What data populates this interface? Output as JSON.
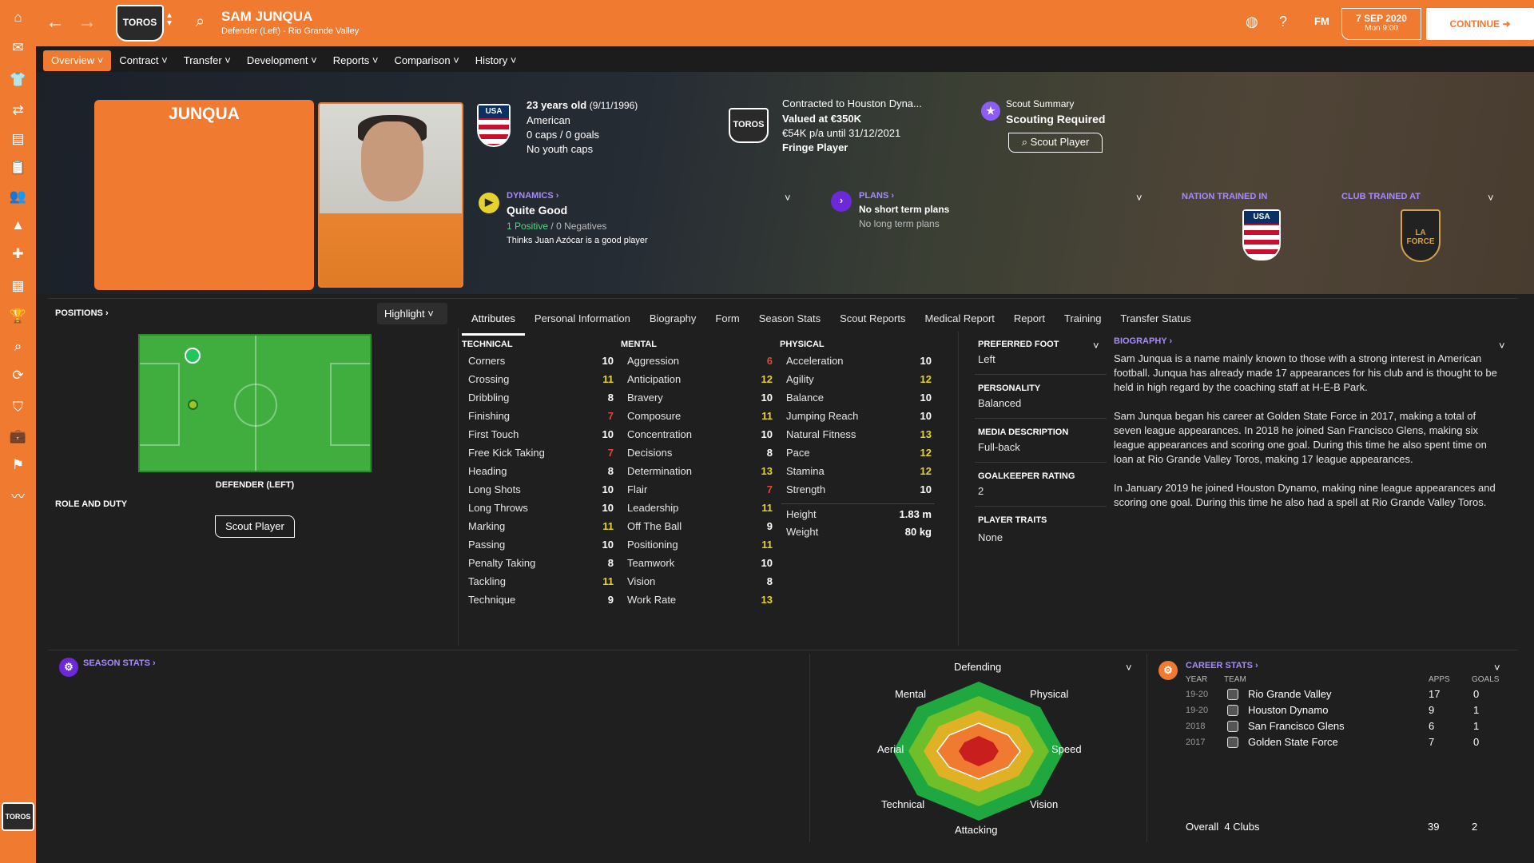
{
  "colors": {
    "accent": "#f07a2f",
    "purple": "#a78bfa",
    "green": "#3fae3f",
    "value_red": "#e0483a",
    "value_yellow": "#e6d22d",
    "value_white": "#ffffff"
  },
  "sidebar": {
    "icons": [
      "home-icon",
      "inbox-icon",
      "squad-icon",
      "tactics-icon",
      "data-hub-icon",
      "clipboard-icon",
      "staff-icon",
      "training-icon",
      "medical-icon",
      "schedule-icon",
      "competitions-icon",
      "scouting-icon",
      "transfers-icon",
      "club-info-icon",
      "finances-icon",
      "dev-centre-icon",
      "analytics-icon"
    ],
    "club_logo": "TOROS"
  },
  "header": {
    "club_badge": "TOROS",
    "player_name": "SAM JUNQUA",
    "player_subtitle": "Defender (Left) - Rio Grande Valley",
    "fm_label": "FM",
    "date": "7 SEP 2020",
    "time": "Mon 9:00",
    "continue_label": "CONTINUE"
  },
  "tabs": [
    {
      "label": "Overview"
    },
    {
      "label": "Contract"
    },
    {
      "label": "Transfer"
    },
    {
      "label": "Development"
    },
    {
      "label": "Reports"
    },
    {
      "label": "Comparison"
    },
    {
      "label": "History"
    }
  ],
  "hero": {
    "shirt_name": "JUNQUA",
    "nation_badge": "USA",
    "age_line": "23 years old",
    "dob": "(9/11/1996)",
    "nationality": "American",
    "caps": "0 caps / 0 goals",
    "youth_caps": "No youth caps",
    "contract_badge": "TOROS",
    "contracted_to": "Contracted to Houston Dyna...",
    "valued_at": "Valued at €350K",
    "wage": "€54K p/a until 31/12/2021",
    "squad_status": "Fringe Player",
    "scout_summary_label": "Scout Summary",
    "scout_summary_value": "Scouting Required",
    "scout_player_btn": "Scout Player",
    "dynamics_label": "DYNAMICS",
    "dynamics_value": "Quite Good",
    "positives": "1 Positive",
    "negatives": "0 Negatives",
    "dynamics_note": "Thinks Juan Azócar is a good player",
    "plans_label": "PLANS",
    "plans_short": "No short term plans",
    "plans_long": "No long term plans",
    "nation_trained_label": "NATION TRAINED IN",
    "nation_trained_badge": "USA",
    "club_trained_label": "CLUB TRAINED AT",
    "club_trained_badge": "LA FORCE"
  },
  "positions": {
    "label": "POSITIONS",
    "highlight_label": "Highlight",
    "position_name": "DEFENDER (LEFT)",
    "role_duty_label": "ROLE AND DUTY",
    "scout_btn": "Scout Player"
  },
  "sub_tabs": [
    "Attributes",
    "Personal Information",
    "Biography",
    "Form",
    "Season Stats",
    "Scout Reports",
    "Medical Report",
    "Report",
    "Training",
    "Transfer Status"
  ],
  "attributes": {
    "technical_label": "TECHNICAL",
    "mental_label": "MENTAL",
    "physical_label": "PHYSICAL",
    "technical": [
      [
        "Corners",
        "10",
        "w"
      ],
      [
        "Crossing",
        "11",
        "y"
      ],
      [
        "Dribbling",
        "8",
        "w"
      ],
      [
        "Finishing",
        "7",
        "r"
      ],
      [
        "First Touch",
        "10",
        "w"
      ],
      [
        "Free Kick Taking",
        "7",
        "r"
      ],
      [
        "Heading",
        "8",
        "w"
      ],
      [
        "Long Shots",
        "10",
        "w"
      ],
      [
        "Long Throws",
        "10",
        "w"
      ],
      [
        "Marking",
        "11",
        "y"
      ],
      [
        "Passing",
        "10",
        "w"
      ],
      [
        "Penalty Taking",
        "8",
        "w"
      ],
      [
        "Tackling",
        "11",
        "y"
      ],
      [
        "Technique",
        "9",
        "w"
      ]
    ],
    "mental": [
      [
        "Aggression",
        "6",
        "r"
      ],
      [
        "Anticipation",
        "12",
        "y"
      ],
      [
        "Bravery",
        "10",
        "w"
      ],
      [
        "Composure",
        "11",
        "y"
      ],
      [
        "Concentration",
        "10",
        "w"
      ],
      [
        "Decisions",
        "8",
        "w"
      ],
      [
        "Determination",
        "13",
        "y"
      ],
      [
        "Flair",
        "7",
        "r"
      ],
      [
        "Leadership",
        "11",
        "y"
      ],
      [
        "Off The Ball",
        "9",
        "w"
      ],
      [
        "Positioning",
        "11",
        "y"
      ],
      [
        "Teamwork",
        "10",
        "w"
      ],
      [
        "Vision",
        "8",
        "w"
      ],
      [
        "Work Rate",
        "13",
        "y"
      ]
    ],
    "physical": [
      [
        "Acceleration",
        "10",
        "w"
      ],
      [
        "Agility",
        "12",
        "y"
      ],
      [
        "Balance",
        "10",
        "w"
      ],
      [
        "Jumping Reach",
        "10",
        "w"
      ],
      [
        "Natural Fitness",
        "13",
        "y"
      ],
      [
        "Pace",
        "12",
        "y"
      ],
      [
        "Stamina",
        "12",
        "y"
      ],
      [
        "Strength",
        "10",
        "w"
      ]
    ],
    "height_label": "Height",
    "height": "1.83 m",
    "weight_label": "Weight",
    "weight": "80 kg"
  },
  "info": {
    "preferred_foot_label": "PREFERRED FOOT",
    "preferred_foot": "Left",
    "personality_label": "PERSONALITY",
    "personality": "Balanced",
    "media_label": "MEDIA DESCRIPTION",
    "media": "Full-back",
    "gk_label": "GOALKEEPER RATING",
    "gk": "2",
    "traits_label": "PLAYER TRAITS",
    "traits": "None"
  },
  "biography": {
    "label": "BIOGRAPHY",
    "p1": "Sam Junqua is a name mainly known to those with a strong interest in American football. Junqua has already made 17 appearances for his club and is thought to be held in high regard by the coaching staff at H-E-B Park.",
    "p2": "Sam Junqua began his career at Golden State Force in 2017, making a total of seven league appearances. In 2018 he joined San Francisco Glens, making six league appearances and scoring one goal. During this time he also spent time on loan at Rio Grande Valley Toros, making 17 league appearances.",
    "p3": "In January 2019 he joined Houston Dynamo, making nine league appearances and scoring one goal. During this time he also had a spell at Rio Grande Valley Toros."
  },
  "season_stats": {
    "label": "SEASON STATS"
  },
  "radar": {
    "top": "Defending",
    "top_right": "Physical",
    "right": "Speed",
    "bottom_right": "Vision",
    "bottom": "Attacking",
    "bottom_left": "Technical",
    "left": "Aerial",
    "top_left": "Mental"
  },
  "career": {
    "label": "CAREER STATS",
    "h_year": "YEAR",
    "h_team": "TEAM",
    "h_apps": "APPS",
    "h_goals": "GOALS",
    "rows": [
      [
        "19-20",
        "Rio Grande Valley",
        "17",
        "0"
      ],
      [
        "19-20",
        "Houston Dynamo",
        "9",
        "1"
      ],
      [
        "2018",
        "San Francisco Glens",
        "6",
        "1"
      ],
      [
        "2017",
        "Golden State Force",
        "7",
        "0"
      ]
    ],
    "overall_label": "Overall",
    "overall_clubs": "4 Clubs",
    "overall_apps": "39",
    "overall_goals": "2"
  }
}
